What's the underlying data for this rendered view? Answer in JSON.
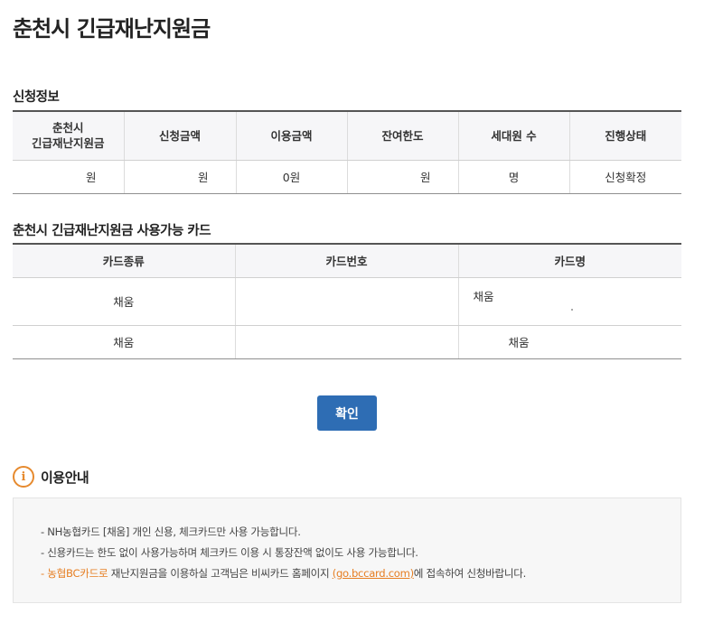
{
  "page": {
    "title": "춘천시 긴급재난지원금"
  },
  "application_info": {
    "section_title": "신청정보",
    "headers": [
      "춘천시\n긴급재난지원금",
      "신청금액",
      "이용금액",
      "잔여한도",
      "세대원 수",
      "진행상태"
    ],
    "row": [
      "원",
      "원",
      "0원",
      "원",
      "명",
      "신청확정"
    ]
  },
  "cards": {
    "section_title": "춘천시 긴급재난지원금 사용가능 카드",
    "headers": [
      "카드종류",
      "카드번호",
      "카드명"
    ],
    "rows": [
      {
        "type": "채움",
        "number": "",
        "name": "채움"
      },
      {
        "type": "채움",
        "number": "",
        "name": "채움"
      }
    ]
  },
  "confirm_button": {
    "label": "확인",
    "color": "#2e6db4"
  },
  "guide": {
    "title": "이용안내",
    "icon": "info-icon",
    "accent_color": "#e67e22",
    "line1": "- NH농협카드 [채움] 개인 신용, 체크카드만 사용 가능합니다.",
    "line2": "- 신용카드는 한도 없이 사용가능하며 체크카드 이용 시 통장잔액 없이도 사용 가능합니다.",
    "line3_prefix": "- ",
    "line3_highlight": "농협BC카드로",
    "line3_middle": " 재난지원금을 이용하실 고객님은 비씨카드 홈페이지 ",
    "line3_link": "(go.bccard.com)",
    "line3_suffix": "에 접속하여 신청바랍니다."
  }
}
